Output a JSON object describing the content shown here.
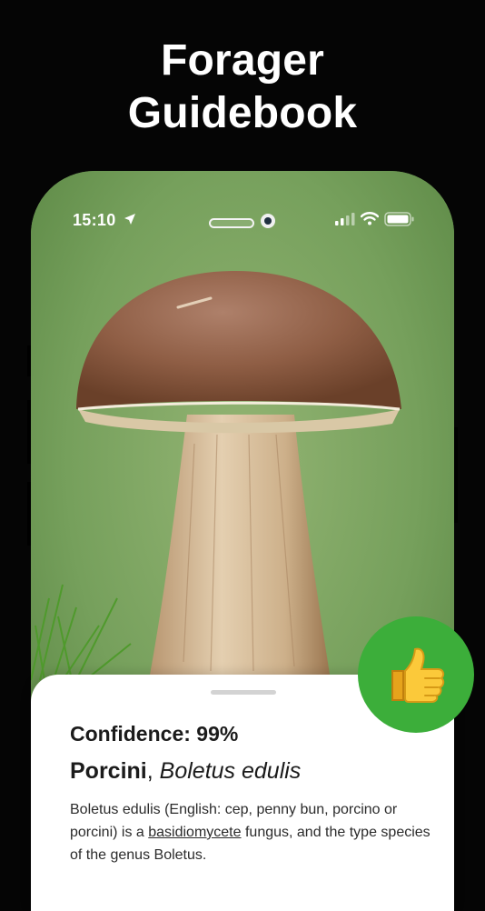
{
  "promo": {
    "title_line1": "Forager",
    "title_line2": "Guidebook"
  },
  "status_bar": {
    "time": "15:10"
  },
  "result": {
    "confidence": "Confidence: 99%",
    "common_name": "Porcini",
    "separator": ", ",
    "scientific_name": "Boletus edulis",
    "description_part1": "Boletus edulis (English: cep, penny bun, porcino or porcini) is a ",
    "description_link": "basidiomycete",
    "description_part2": " fungus, and the type species of the genus Boletus."
  },
  "icons": {
    "location": "location-arrow-icon",
    "signal": "cellular-signal-icon",
    "wifi": "wifi-icon",
    "battery": "battery-icon",
    "like": "thumbs-up-icon"
  },
  "colors": {
    "background": "#050505",
    "accent_green": "#3cae3a",
    "sheet": "#ffffff",
    "text": "#1b1b1b"
  }
}
